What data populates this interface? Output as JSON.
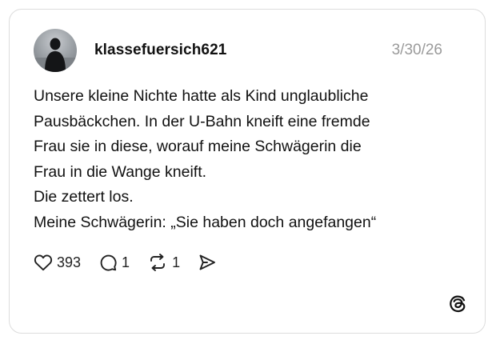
{
  "post": {
    "username": "klassefuersich621",
    "date": "3/30/26",
    "lines": [
      "Unsere kleine Nichte hatte als Kind unglaubliche",
      "Pausbäckchen. In der U-Bahn kneift eine fremde",
      "Frau sie in diese, worauf meine Schwägerin die",
      "Frau in die Wange kneift.",
      "Die zettert los.",
      "Meine Schwägerin: „Sie haben doch angefangen“"
    ],
    "actions": {
      "likes": "393",
      "replies": "1",
      "reposts": "1"
    },
    "icons": {
      "like": "heart-icon",
      "reply": "speech-bubble-icon",
      "repost": "repost-arrows-icon",
      "share": "send-icon",
      "brand": "threads-logo-icon"
    }
  }
}
